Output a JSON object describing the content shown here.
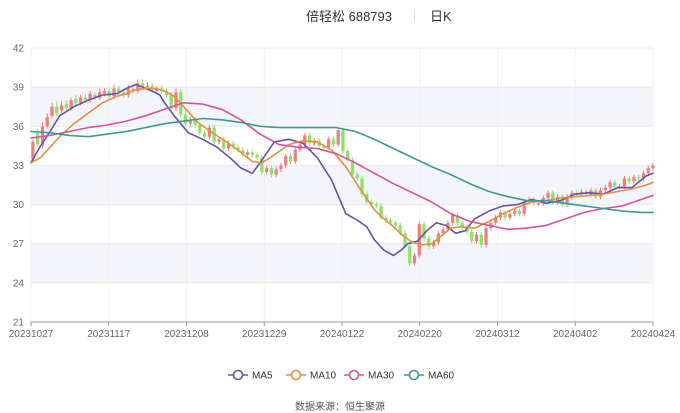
{
  "header": {
    "title": "倍轻松 688793",
    "period": "日K"
  },
  "footer": {
    "source": "数据来源：恒生聚源"
  },
  "colors": {
    "up": "#f07e7e",
    "down": "#8fe067",
    "band": "#f3f5fb",
    "grid": "#e8e8e8",
    "ma5": "#6a4fb3",
    "ma10": "#e5913b",
    "ma30": "#d9509f",
    "ma60": "#3b9a94"
  },
  "chart_data": {
    "type": "candlestick",
    "y_ticks": [
      "42",
      "39",
      "36",
      "33",
      "30",
      "27",
      "24",
      "21"
    ],
    "ylim": [
      21,
      42
    ],
    "x_ticks": [
      "20231027",
      "20231117",
      "20231208",
      "20231229",
      "20240122",
      "20240220",
      "20240312",
      "20240402",
      "20240424"
    ],
    "legend": [
      "MA5",
      "MA10",
      "MA30",
      "MA60"
    ],
    "series": [
      {
        "name": "MA5",
        "x": [
          0,
          10,
          20,
          30,
          45,
          60,
          75,
          90,
          100,
          110,
          120,
          130,
          135,
          140,
          150,
          165,
          180,
          195,
          210,
          220,
          232,
          240,
          255,
          270,
          285,
          300,
          315,
          330,
          342,
          352,
          360,
          370,
          380,
          388,
          395,
          405,
          415,
          425,
          435,
          445,
          455,
          465,
          480,
          495,
          510,
          525,
          540,
          555,
          570,
          585,
          600,
          615,
          630,
          645,
          652
        ],
        "y": [
          33.2,
          34.5,
          35.6,
          36.8,
          37.5,
          38.0,
          38.4,
          38.5,
          38.9,
          39.2,
          38.9,
          38.6,
          38.4,
          37.8,
          36.8,
          35.5,
          35.0,
          34.4,
          33.5,
          32.8,
          32.4,
          33.2,
          34.8,
          35.0,
          34.7,
          33.6,
          31.9,
          29.3,
          28.8,
          28.3,
          27.3,
          26.5,
          26.1,
          26.5,
          27.0,
          27.2,
          28.0,
          28.6,
          28.4,
          27.8,
          28.0,
          28.9,
          29.5,
          29.9,
          30.0,
          30.4,
          30.1,
          30.3,
          30.8,
          30.9,
          30.8,
          31.3,
          31.3,
          32.2,
          32.4
        ]
      },
      {
        "name": "MA10",
        "x": [
          0,
          10,
          20,
          30,
          45,
          60,
          75,
          90,
          100,
          110,
          120,
          130,
          140,
          150,
          160,
          175,
          190,
          205,
          220,
          232,
          242,
          255,
          270,
          285,
          300,
          315,
          330,
          345,
          360,
          370,
          380,
          390,
          400,
          410,
          420,
          430,
          440,
          450,
          465,
          480,
          495,
          510,
          525,
          540,
          555,
          570,
          585,
          600,
          615,
          630,
          645,
          652
        ],
        "y": [
          33.2,
          33.6,
          34.4,
          35.2,
          36.2,
          37.0,
          37.8,
          38.3,
          38.5,
          38.8,
          38.9,
          38.9,
          38.7,
          38.3,
          37.5,
          36.3,
          35.5,
          34.8,
          34.0,
          33.3,
          33.2,
          33.8,
          34.6,
          34.9,
          34.8,
          34.2,
          32.9,
          31.2,
          29.6,
          28.9,
          28.3,
          27.6,
          27.1,
          26.9,
          27.0,
          27.6,
          28.2,
          28.3,
          28.2,
          28.7,
          29.3,
          29.8,
          30.2,
          30.3,
          30.5,
          30.6,
          30.7,
          30.8,
          31.0,
          31.2,
          31.5,
          31.7
        ]
      },
      {
        "name": "MA30",
        "x": [
          0,
          20,
          40,
          60,
          80,
          100,
          120,
          140,
          160,
          180,
          200,
          220,
          240,
          260,
          280,
          300,
          320,
          340,
          360,
          380,
          400,
          420,
          440,
          460,
          480,
          500,
          520,
          540,
          560,
          580,
          600,
          620,
          640,
          652
        ],
        "y": [
          35.1,
          35.3,
          35.6,
          35.9,
          36.1,
          36.4,
          36.8,
          37.3,
          37.8,
          37.7,
          37.3,
          36.5,
          35.4,
          34.6,
          34.4,
          34.3,
          33.9,
          33.2,
          32.4,
          31.6,
          30.9,
          30.2,
          29.3,
          28.7,
          28.4,
          28.1,
          28.2,
          28.4,
          28.9,
          29.4,
          29.7,
          29.9,
          30.4,
          30.7
        ]
      },
      {
        "name": "MA60",
        "x": [
          0,
          20,
          40,
          60,
          80,
          100,
          120,
          140,
          160,
          180,
          200,
          220,
          240,
          260,
          280,
          300,
          320,
          340,
          360,
          380,
          400,
          420,
          440,
          460,
          480,
          500,
          520,
          540,
          560,
          580,
          600,
          620,
          640,
          652
        ],
        "y": [
          35.6,
          35.5,
          35.3,
          35.2,
          35.4,
          35.6,
          35.9,
          36.2,
          36.4,
          36.6,
          36.5,
          36.3,
          36.0,
          35.9,
          35.9,
          35.9,
          35.9,
          35.6,
          35.0,
          34.3,
          33.6,
          32.9,
          32.3,
          31.6,
          31.0,
          30.6,
          30.3,
          30.3,
          30.1,
          29.9,
          29.7,
          29.5,
          29.4,
          29.4
        ]
      }
    ],
    "candles": {
      "x": [
        2,
        7,
        12,
        17,
        22,
        27,
        32,
        37,
        42,
        47,
        52,
        57,
        62,
        67,
        72,
        77,
        82,
        87,
        92,
        97,
        102,
        107,
        112,
        117,
        122,
        127,
        132,
        137,
        142,
        147,
        152,
        157,
        162,
        167,
        172,
        177,
        182,
        187,
        192,
        197,
        202,
        207,
        212,
        217,
        222,
        227,
        232,
        237,
        242,
        247,
        252,
        257,
        262,
        267,
        272,
        277,
        282,
        287,
        292,
        297,
        302,
        307,
        312,
        317,
        322,
        327,
        332,
        337,
        342,
        347,
        352,
        357,
        362,
        367,
        372,
        377,
        382,
        387,
        392,
        397,
        402,
        407,
        412,
        417,
        422,
        427,
        432,
        437,
        442,
        447,
        452,
        457,
        462,
        467,
        472,
        477,
        482,
        487,
        492,
        497,
        502,
        507,
        512,
        517,
        522,
        527,
        532,
        537,
        542,
        547,
        552,
        557,
        562,
        567,
        572,
        577,
        582,
        587,
        592,
        597,
        602,
        607,
        612,
        617,
        622,
        627,
        632,
        637,
        642,
        647,
        652
      ],
      "open": [
        33.5,
        35.5,
        34.5,
        36.0,
        36.8,
        37.5,
        37.2,
        37.7,
        37.4,
        38.1,
        37.8,
        38.2,
        38.0,
        38.4,
        38.2,
        38.5,
        38.7,
        38.3,
        38.9,
        38.6,
        38.4,
        38.9,
        38.7,
        39.3,
        39.0,
        39.1,
        38.7,
        38.9,
        38.7,
        38.4,
        37.4,
        38.6,
        36.9,
        36.2,
        36.5,
        36.1,
        35.5,
        35.2,
        35.9,
        34.8,
        35.0,
        34.3,
        34.7,
        34.4,
        34.2,
        33.8,
        34.0,
        33.8,
        33.6,
        32.5,
        32.8,
        32.3,
        32.7,
        33.0,
        33.7,
        33.3,
        34.2,
        34.6,
        35.3,
        34.7,
        34.9,
        34.5,
        34.4,
        35.0,
        34.6,
        35.7,
        34.1,
        33.4,
        32.3,
        32.0,
        30.8,
        30.2,
        30.0,
        29.9,
        29.0,
        28.8,
        28.6,
        28.4,
        27.8,
        26.8,
        25.5,
        26.1,
        28.5,
        27.4,
        26.8,
        27.1,
        27.8,
        28.1,
        28.6,
        29.2,
        28.6,
        28.3,
        27.9,
        27.2,
        27.7,
        26.9,
        28.2,
        28.6,
        29.0,
        29.4,
        29.0,
        29.3,
        29.5,
        29.3,
        30.2,
        30.4,
        30.1,
        30.1,
        30.5,
        30.9,
        30.2,
        30.6,
        30.0,
        30.6,
        30.9,
        30.8,
        31.0,
        30.8,
        31.1,
        30.6,
        31.1,
        31.3,
        31.7,
        31.4,
        31.4,
        32.0,
        31.8,
        32.1,
        32.0,
        32.4,
        32.8
      ],
      "close": [
        34.8,
        34.6,
        36.0,
        36.7,
        37.5,
        37.0,
        37.6,
        37.4,
        38.0,
        37.8,
        38.2,
        38.0,
        38.5,
        38.2,
        38.6,
        38.7,
        38.3,
        38.9,
        38.6,
        38.4,
        38.9,
        38.7,
        39.3,
        39.0,
        39.1,
        38.8,
        38.9,
        38.7,
        38.4,
        37.4,
        38.6,
        36.9,
        36.2,
        36.5,
        36.1,
        35.5,
        35.2,
        35.9,
        34.8,
        35.0,
        34.3,
        34.7,
        34.4,
        34.2,
        33.8,
        34.0,
        33.8,
        33.6,
        32.5,
        32.8,
        32.3,
        32.7,
        33.0,
        33.7,
        33.3,
        34.2,
        34.6,
        35.3,
        34.7,
        34.9,
        34.5,
        34.4,
        35.0,
        34.6,
        35.7,
        34.1,
        33.4,
        32.3,
        32.0,
        30.8,
        30.2,
        30.0,
        29.9,
        29.0,
        28.8,
        28.6,
        28.4,
        27.8,
        26.8,
        25.5,
        26.1,
        28.5,
        27.4,
        26.8,
        27.1,
        27.8,
        28.1,
        28.6,
        29.2,
        28.6,
        28.3,
        27.9,
        27.2,
        27.7,
        26.9,
        28.2,
        28.6,
        29.0,
        29.4,
        29.0,
        29.3,
        29.5,
        29.3,
        30.2,
        30.4,
        30.1,
        30.1,
        30.5,
        30.9,
        30.2,
        30.6,
        30.0,
        30.6,
        30.9,
        30.8,
        31.0,
        30.8,
        31.1,
        30.6,
        31.1,
        31.3,
        31.7,
        31.4,
        31.4,
        32.0,
        31.8,
        32.1,
        32.0,
        32.4,
        32.8,
        33.0
      ],
      "high": [
        35.0,
        35.8,
        36.3,
        37.0,
        37.8,
        37.9,
        37.9,
        38.0,
        38.2,
        38.4,
        38.4,
        38.5,
        38.7,
        38.6,
        38.9,
        38.9,
        38.9,
        39.2,
        39.1,
        38.9,
        39.2,
        39.1,
        39.6,
        39.6,
        39.4,
        39.3,
        39.1,
        39.1,
        38.9,
        38.6,
        38.9,
        38.8,
        37.3,
        36.7,
        36.7,
        36.3,
        35.7,
        36.1,
        36.1,
        35.2,
        35.2,
        34.9,
        34.9,
        34.6,
        34.4,
        34.2,
        34.2,
        34.0,
        33.8,
        33.0,
        33.0,
        32.9,
        33.2,
        33.9,
        33.9,
        34.4,
        34.8,
        35.5,
        35.5,
        35.1,
        35.1,
        34.7,
        35.2,
        35.2,
        35.9,
        35.9,
        34.3,
        33.6,
        32.5,
        32.2,
        31.0,
        30.4,
        30.2,
        30.1,
        29.2,
        29.0,
        28.8,
        28.6,
        28.0,
        27.0,
        26.3,
        28.7,
        28.7,
        27.6,
        27.3,
        28.0,
        28.3,
        28.8,
        29.4,
        29.4,
        28.8,
        28.5,
        28.1,
        27.9,
        27.9,
        28.4,
        28.8,
        29.2,
        29.6,
        29.6,
        29.5,
        29.7,
        29.7,
        30.4,
        30.6,
        30.6,
        30.3,
        30.7,
        31.1,
        31.1,
        30.8,
        30.8,
        30.8,
        31.1,
        31.1,
        31.2,
        31.2,
        31.3,
        31.3,
        31.3,
        31.5,
        31.9,
        31.9,
        31.6,
        32.2,
        32.2,
        32.3,
        32.3,
        32.6,
        33.0,
        33.2
      ],
      "low": [
        33.3,
        34.4,
        34.3,
        35.8,
        36.6,
        36.8,
        37.0,
        37.2,
        37.2,
        37.6,
        37.6,
        37.8,
        37.8,
        38.0,
        38.0,
        38.3,
        38.1,
        38.1,
        38.4,
        38.2,
        38.2,
        38.5,
        38.5,
        38.8,
        38.8,
        38.6,
        38.5,
        38.5,
        38.2,
        37.2,
        37.2,
        36.7,
        36.0,
        36.0,
        35.9,
        35.3,
        35.0,
        35.0,
        34.6,
        34.6,
        34.1,
        34.1,
        34.2,
        34.0,
        33.6,
        33.6,
        33.6,
        33.4,
        32.3,
        32.3,
        32.1,
        32.1,
        32.5,
        32.8,
        33.1,
        33.1,
        34.0,
        34.4,
        34.5,
        34.5,
        34.3,
        34.2,
        34.2,
        34.4,
        34.4,
        33.9,
        33.2,
        32.1,
        31.8,
        30.6,
        30.0,
        29.8,
        29.7,
        28.8,
        28.6,
        28.4,
        28.2,
        27.6,
        26.6,
        25.3,
        25.3,
        25.9,
        27.2,
        26.6,
        26.6,
        26.9,
        27.6,
        27.9,
        28.4,
        28.4,
        28.1,
        27.7,
        27.0,
        27.0,
        26.7,
        26.7,
        28.0,
        28.4,
        28.8,
        28.8,
        28.8,
        29.1,
        29.1,
        29.1,
        30.0,
        29.9,
        29.9,
        29.9,
        30.3,
        30.0,
        30.0,
        29.8,
        29.8,
        30.4,
        30.6,
        30.6,
        30.6,
        30.6,
        30.4,
        30.4,
        30.9,
        31.1,
        31.2,
        31.2,
        31.2,
        31.6,
        31.6,
        31.8,
        31.8,
        32.2,
        32.6
      ]
    }
  }
}
